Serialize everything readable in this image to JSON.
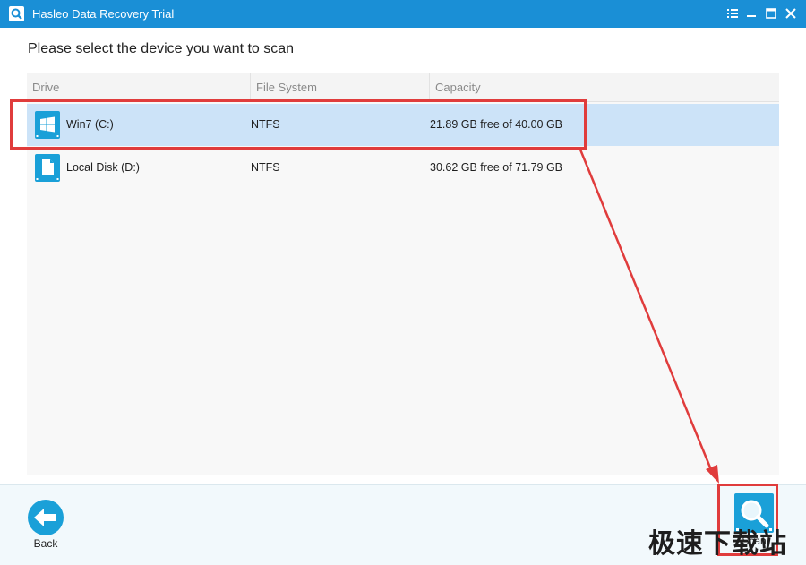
{
  "window": {
    "title": "Hasleo Data Recovery Trial"
  },
  "heading": "Please select the device you want to scan",
  "table": {
    "columns": [
      "Drive",
      "File System",
      "Capacity"
    ],
    "rows": [
      {
        "drive": "Win7 (C:)",
        "file_system": "NTFS",
        "capacity": "21.89 GB free of 40.00 GB",
        "icon": "windows-drive-icon",
        "selected": true
      },
      {
        "drive": "Local Disk (D:)",
        "file_system": "NTFS",
        "capacity": "30.62 GB free of 71.79 GB",
        "icon": "disk-file-icon",
        "selected": false
      }
    ]
  },
  "footer": {
    "back_label": "Back",
    "scan_label": "Scan"
  },
  "watermark": "极速下载站",
  "colors": {
    "titlebar": "#1a8fd6",
    "accent": "#1aa0d8",
    "selected_row": "#cce3f8",
    "annotation": "#e03c3c"
  }
}
